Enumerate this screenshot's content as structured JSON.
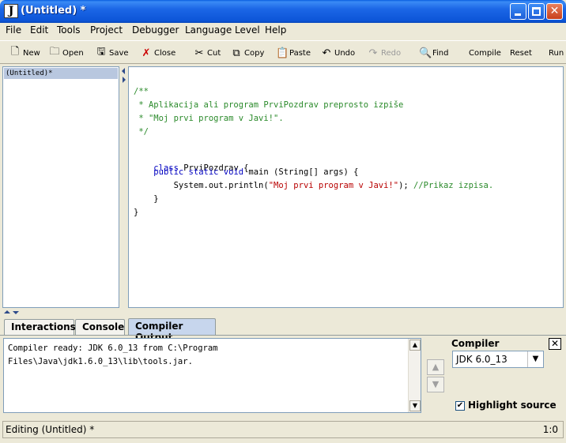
{
  "window": {
    "title": "(Untitled) *",
    "app_icon": "J"
  },
  "menu": [
    "File",
    "Edit",
    "Tools",
    "Project",
    "Debugger",
    "Language Level",
    "Help"
  ],
  "toolbar": {
    "new": "New",
    "open": "Open",
    "save": "Save",
    "close": "Close",
    "cut": "Cut",
    "copy": "Copy",
    "paste": "Paste",
    "undo": "Undo",
    "redo": "Redo",
    "find": "Find",
    "compile": "Compile",
    "reset": "Reset",
    "run": "Run"
  },
  "documents": [
    "(Untitled)*"
  ],
  "editor": {
    "lines": [
      "/**",
      " * Aplikacija ali program PrviPozdrav preprosto izpiše",
      " * \"Moj prvi program v Javi!\".",
      " */",
      "",
      "class PrviPozdrav {",
      "    public static void main (String[] args) {",
      "        System.out.println(\"Moj prvi program v Javi!\"); //Prikaz izpisa.",
      "    }",
      "}"
    ]
  },
  "tabs": [
    "Interactions",
    "Console",
    "Compiler Output"
  ],
  "output": {
    "lines": [
      "Compiler ready: JDK 6.0_13 from C:\\Program",
      "Files\\Java\\jdk1.6.0_13\\lib\\tools.jar."
    ]
  },
  "compiler_panel": {
    "label": "Compiler",
    "selected": "JDK 6.0_13",
    "highlight_label": "Highlight source",
    "highlight_checked": true
  },
  "status": {
    "text": "Editing (Untitled) *",
    "position": "1:0"
  },
  "colors": {
    "title_bar": "#0c55d8",
    "comment": "#2a8a2a",
    "keyword": "#0000c0",
    "string": "#b80000",
    "selected_doc": "#b8c7df",
    "active_tab": "#c7d6ed"
  }
}
